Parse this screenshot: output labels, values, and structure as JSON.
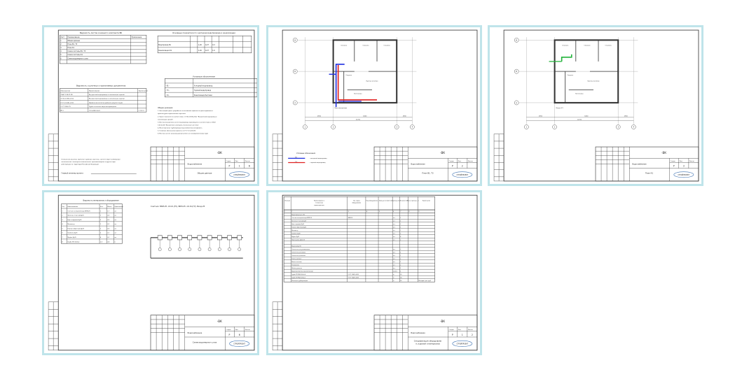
{
  "colors": {
    "card_border": "#bfe4ea",
    "cold_water": "#1f2fe0",
    "hot_water": "#e02020",
    "sewer": "#22b33a"
  },
  "stamp": {
    "code": "-ВК",
    "section": "Водоснабжение",
    "sheet_label": "Лист",
    "sheets_label": "Листов",
    "stage_label": "Стадия",
    "stage": "Р",
    "company": "СТРОЙПРОЕКТ"
  },
  "sheets": [
    {
      "title": "Общие данные",
      "num": "1",
      "total": "6",
      "list_title": "Ведомость листов основного комплекта ВК",
      "list_head": [
        "Лист",
        "Наименование",
        "Примечание"
      ],
      "list_rows": [
        [
          "1",
          "Общие данные"
        ],
        [
          "2",
          "План В1, Т3"
        ],
        [
          "3",
          "План К1"
        ],
        [
          "4",
          "Схема системы В1, Т3"
        ],
        [
          "5",
          "Схема системы К1"
        ],
        [
          "6",
          "Схема водомерного узла"
        ]
      ],
      "docs_title": "Ведомость ссылочных и прилагаемых документов",
      "docs_head": [
        "Обозначение",
        "Наименование",
        "Примечание"
      ],
      "docs_rows": [
        [
          "СНиП 2.04.01-85",
          "Внутренний водопровод и канализация зданий"
        ],
        [
          "СП 30.13330.2012",
          "Внутренний водопровод и канализация зданий"
        ],
        [
          "ГОСТ 21.601-2011",
          "Правила выполнения рабочей документации"
        ],
        [
          "ГОСТ 3262-75",
          "Трубы стальные водогазопроводные"
        ],
        [
          "ВК.С",
          "Спецификация",
          "2 листа"
        ]
      ],
      "main_title": "Основные показатели по чертежам водопровода и канализации",
      "main_rows": [
        [
          "Водопровод В1",
          "1,26",
          "0,27",
          "0,3"
        ],
        [
          "Канализация К1",
          "1,26",
          "0,27",
          "1,6"
        ]
      ],
      "legend_title": "Условные обозначения",
      "legend_rows": [
        [
          "- В1 -",
          "Холодный водопровод"
        ],
        [
          "- Т3 -",
          "Горячий водопровод"
        ],
        [
          "- К1 -",
          "Канализация бытовая"
        ]
      ],
      "notes_title": "Общие указания",
      "notes": [
        "1. Настоящий проект разработан на основании задания на проектирование и",
        "архитектурно-строительных чертежей.",
        "2. Проект выполнен в соответствии с СП 30.13330.2012 \"Внутренний водопровод и",
        "канализация зданий\".",
        "3. Монтаж внутренних систем водопровода производить в соответствии со СНиП",
        "3.05.01-85 \"Внутренние санитарно-технические системы\".",
        "4. Магистральные трубопроводы водоснабжения изолировать.",
        "5. Условные обозначения приняты по ГОСТ 21.205-93.",
        "6. Монтаж систем канализации выполнить из полипропиленовых труб."
      ],
      "cert": "Технические решения, принятые в рабочих чертежах, соответствуют требованиям экологических, санитарно-гигиенических, противопожарных и других норм, действующих на территории Российской Федерации.",
      "chief": "Главный инженер проекта"
    },
    {
      "title": "План В1, Т3",
      "num": "2",
      "total": "",
      "rooms": [
        "Спальня",
        "Спальня",
        "Спальня",
        "Санузел",
        "Кухня-гостиная",
        "Котельная",
        "Ввод водопровода"
      ],
      "axes": [
        "1",
        "2",
        "3",
        "4",
        "А",
        "Б",
        "В"
      ],
      "dims": [
        "2900",
        "6200",
        "2900",
        "11700"
      ],
      "legend_title": "Условные обозначения",
      "legend": [
        {
          "code": "В1",
          "label": "холодный водопровод"
        },
        {
          "code": "Т3",
          "label": "горячий водопровод"
        }
      ]
    },
    {
      "title": "План К1",
      "num": "3",
      "total": "",
      "rooms": [
        "Спальня",
        "Спальня",
        "Спальня",
        "Санузел",
        "Кухня-гостиная",
        "Котельная",
        "Выпуск К1"
      ]
    },
    {
      "title": "Схема водомерного узла",
      "num": "6",
      "total": "",
      "spec_title": "Ведомость материалов и оборудования",
      "formula": "Счетчик: ВКМ-25 -СХ-Ф-(ГУ), ВКМ-25 -СХ-Ф-(ГУ), Вкод-25",
      "head": [
        "Поз.",
        "Наименование",
        "Кол.",
        "Масса",
        "Примечание"
      ],
      "rows": [
        [
          "1",
          "Счетчик холодной воды ВКМ-25",
          "1",
          "1,7",
          "шт."
        ],
        [
          "2",
          "Фильтр сетчатый Ду25",
          "1",
          "0,5",
          "шт."
        ],
        [
          "3",
          "Кран шаровой Ду25",
          "2",
          "0,3",
          "шт."
        ],
        [
          "4",
          "Манометр",
          "1",
          "0,2",
          "шт."
        ],
        [
          "5",
          "Клапан обратный Ду25",
          "1",
          "0,3",
          "шт."
        ],
        [
          "6",
          "Тройник Ду25",
          "2",
          "0,1",
          "шт."
        ],
        [
          "7",
          "Муфта Ду25",
          "4",
          "0,1",
          "шт."
        ],
        [
          "8",
          "Труба ПП 32х5,4",
          "2,5",
          "0,6",
          "м"
        ]
      ]
    },
    {
      "title": "Спецификация оборудования, изделий и материалов",
      "num": "1",
      "total": "2",
      "head": [
        "Позиция",
        "Наименование и техническая характеристика",
        "Тип, марка оборудования",
        "Код оборудования",
        "Завод-изготовитель",
        "Единица изм.",
        "Количество",
        "Масса единицы, кг",
        "Примечание"
      ],
      "col_nums": [
        "1",
        "2",
        "3",
        "4",
        "5",
        "6",
        "7",
        "8",
        "9"
      ],
      "group1": "Водомерный узел В1",
      "rows1": [
        [
          "Счетчик холодной воды ВКМ-25",
          "ВКМ-25",
          "шт.",
          "1"
        ],
        [
          "Фильтр сетчатый Ду25",
          "",
          "шт.",
          "1"
        ],
        [
          "Кран шаровой Ду25",
          "",
          "шт.",
          "2"
        ],
        [
          "Клапан обратный Ду25",
          "",
          "шт.",
          "1"
        ],
        [
          "Манометр",
          "",
          "шт.",
          "1"
        ],
        [
          "Тройник Ду25",
          "",
          "шт.",
          "2"
        ],
        [
          "Муфта Ду25",
          "",
          "шт.",
          "4"
        ],
        [
          "Переходник Ду32/25",
          "",
          "шт.",
          "2"
        ]
      ],
      "group2": "Водопровод В1",
      "rows2": [
        [
          "Смеситель для умывальника",
          "",
          "шт.",
          "2"
        ],
        [
          "Смеситель для мойки",
          "",
          "шт.",
          "1"
        ],
        [
          "Смеситель для ванны",
          "",
          "шт.",
          "1"
        ],
        [
          "Унитаз компакт",
          "",
          "шт.",
          "2"
        ],
        [
          "Ванна стальная",
          "",
          "шт.",
          "1"
        ],
        [
          "Умывальник",
          "",
          "шт.",
          "2"
        ],
        [
          "Мойка кухонная",
          "",
          "шт.",
          "1"
        ],
        [
          "Водонагреватель накопительный",
          "",
          "компл.",
          "1"
        ],
        [
          "Труба ПП PN20 32х5,4",
          "ГОСТ 32415-2013",
          "м",
          "25"
        ],
        [
          "Труба ПП PN20 25х4,2",
          "ГОСТ 32415-2013",
          "м",
          "30"
        ],
        [
          "Изоляция трубопроводов",
          "",
          "м",
          "55",
          "Материал для труб"
        ]
      ]
    }
  ]
}
